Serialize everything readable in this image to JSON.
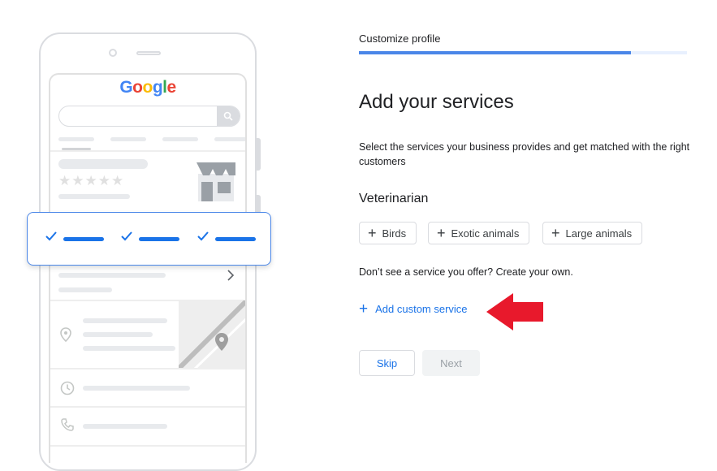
{
  "illustration": {
    "logo_letters": [
      {
        "ch": "G",
        "color": "#4285F4"
      },
      {
        "ch": "o",
        "color": "#EA4335"
      },
      {
        "ch": "o",
        "color": "#FBBC05"
      },
      {
        "ch": "g",
        "color": "#4285F4"
      },
      {
        "ch": "l",
        "color": "#34A853"
      },
      {
        "ch": "e",
        "color": "#EA4335"
      }
    ],
    "stars": "★★★★★"
  },
  "header": {
    "step_label": "Customize profile",
    "progress_percent": 83
  },
  "main": {
    "title": "Add your services",
    "description": "Select the services your business provides and get matched with the right customers",
    "category": "Veterinarian",
    "services": [
      {
        "label": "Birds"
      },
      {
        "label": "Exotic animals"
      },
      {
        "label": "Large animals"
      }
    ],
    "custom_prompt": "Don’t see a service you offer? Create your own.",
    "add_custom_label": "Add custom service"
  },
  "footer": {
    "skip_label": "Skip",
    "next_label": "Next"
  },
  "colors": {
    "accent": "#1a73e8",
    "annotation_arrow": "#e8192c"
  }
}
